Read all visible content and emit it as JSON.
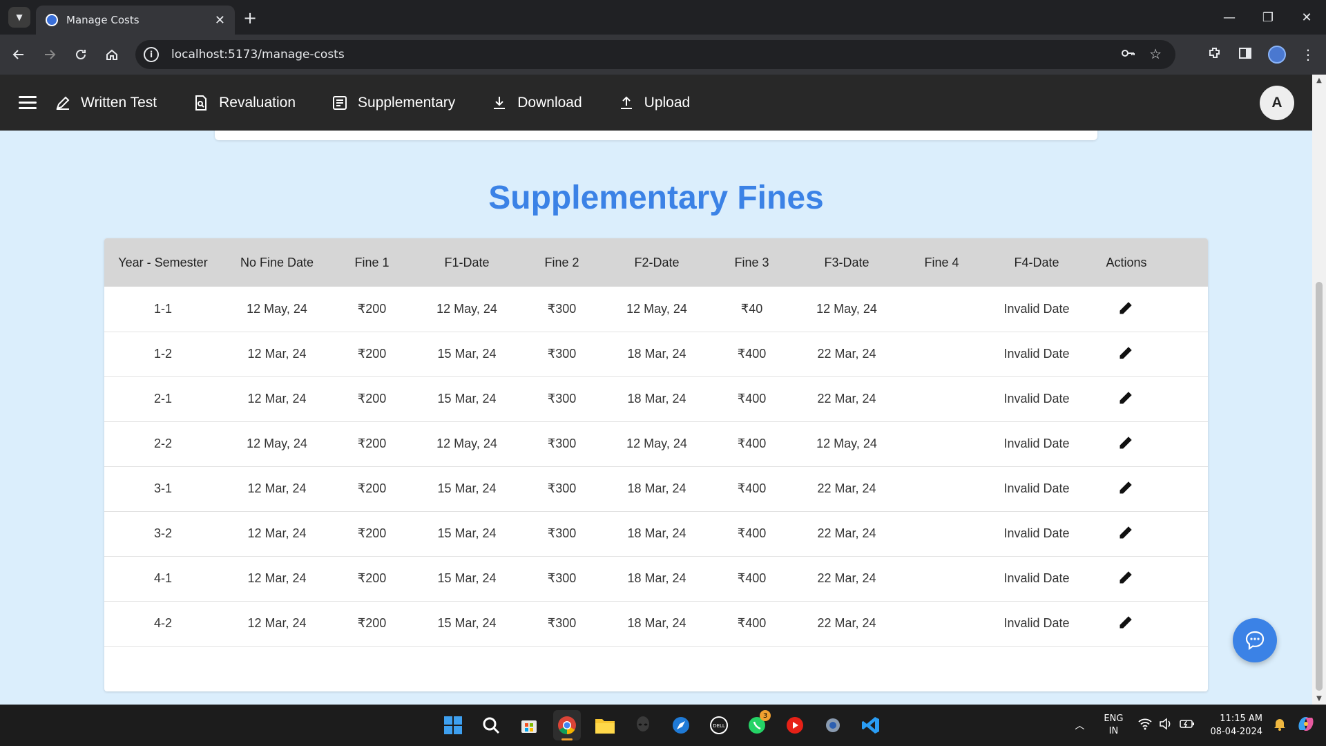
{
  "browser": {
    "tab_title": "Manage Costs",
    "url": "localhost:5173/manage-costs"
  },
  "app": {
    "nav": [
      {
        "label": "Written Test",
        "icon": "edit-pencil-icon"
      },
      {
        "label": "Revaluation",
        "icon": "document-search-icon"
      },
      {
        "label": "Supplementary",
        "icon": "document-list-icon"
      },
      {
        "label": "Download",
        "icon": "download-icon"
      },
      {
        "label": "Upload",
        "icon": "upload-icon"
      }
    ],
    "avatar_initial": "A"
  },
  "page": {
    "title": "Supplementary Fines",
    "accent_color": "#3b82e6"
  },
  "table": {
    "headers": [
      "Year - Semester",
      "No Fine Date",
      "Fine 1",
      "F1-Date",
      "Fine 2",
      "F2-Date",
      "Fine 3",
      "F3-Date",
      "Fine 4",
      "F4-Date",
      "Actions"
    ],
    "rows": [
      [
        "1-1",
        "12 May, 24",
        "₹200",
        "12 May, 24",
        "₹300",
        "12 May, 24",
        "₹40",
        "12 May, 24",
        "",
        "Invalid Date"
      ],
      [
        "1-2",
        "12 Mar, 24",
        "₹200",
        "15 Mar, 24",
        "₹300",
        "18 Mar, 24",
        "₹400",
        "22 Mar, 24",
        "",
        "Invalid Date"
      ],
      [
        "2-1",
        "12 Mar, 24",
        "₹200",
        "15 Mar, 24",
        "₹300",
        "18 Mar, 24",
        "₹400",
        "22 Mar, 24",
        "",
        "Invalid Date"
      ],
      [
        "2-2",
        "12 May, 24",
        "₹200",
        "12 May, 24",
        "₹300",
        "12 May, 24",
        "₹400",
        "12 May, 24",
        "",
        "Invalid Date"
      ],
      [
        "3-1",
        "12 Mar, 24",
        "₹200",
        "15 Mar, 24",
        "₹300",
        "18 Mar, 24",
        "₹400",
        "22 Mar, 24",
        "",
        "Invalid Date"
      ],
      [
        "3-2",
        "12 Mar, 24",
        "₹200",
        "15 Mar, 24",
        "₹300",
        "18 Mar, 24",
        "₹400",
        "22 Mar, 24",
        "",
        "Invalid Date"
      ],
      [
        "4-1",
        "12 Mar, 24",
        "₹200",
        "15 Mar, 24",
        "₹300",
        "18 Mar, 24",
        "₹400",
        "22 Mar, 24",
        "",
        "Invalid Date"
      ],
      [
        "4-2",
        "12 Mar, 24",
        "₹200",
        "15 Mar, 24",
        "₹300",
        "18 Mar, 24",
        "₹400",
        "22 Mar, 24",
        "",
        "Invalid Date"
      ]
    ],
    "row_action_icon": "edit-pencil-icon"
  },
  "taskbar": {
    "apps": [
      "windows-start-icon",
      "search-icon",
      "store-icon",
      "chrome-icon",
      "file-explorer-icon",
      "alienware-icon",
      "browser-icon",
      "dell-icon",
      "whatsapp-icon",
      "youtube-music-icon",
      "settings-icon",
      "vscode-icon"
    ],
    "whatsapp_badge": "3",
    "lang_line1": "ENG",
    "lang_line2": "IN",
    "time": "11:15 AM",
    "date": "08-04-2024"
  }
}
